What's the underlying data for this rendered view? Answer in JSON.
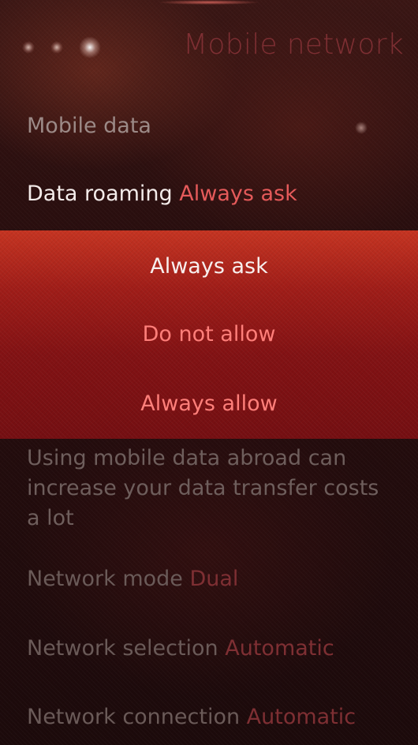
{
  "header": {
    "title": "Mobile network"
  },
  "settings": {
    "mobile_data": {
      "label": "Mobile data"
    },
    "data_roaming": {
      "label": "Data roaming",
      "value": "Always ask"
    },
    "roaming_options": [
      {
        "label": "Always ask",
        "selected": true
      },
      {
        "label": "Do not allow",
        "selected": false
      },
      {
        "label": "Always allow",
        "selected": false
      }
    ],
    "roaming_description": "Using mobile data abroad can increase your data transfer costs a lot",
    "network_mode": {
      "label": "Network mode",
      "value": "Dual"
    },
    "network_selection": {
      "label": "Network selection",
      "value": "Automatic"
    },
    "network_connection": {
      "label": "Network connection",
      "value": "Automatic"
    }
  },
  "colors": {
    "accent": "#e55a5a",
    "highlight_bg": "#a8201e",
    "text_primary": "#f4ecea",
    "text_dim": "#6e5e5c"
  }
}
